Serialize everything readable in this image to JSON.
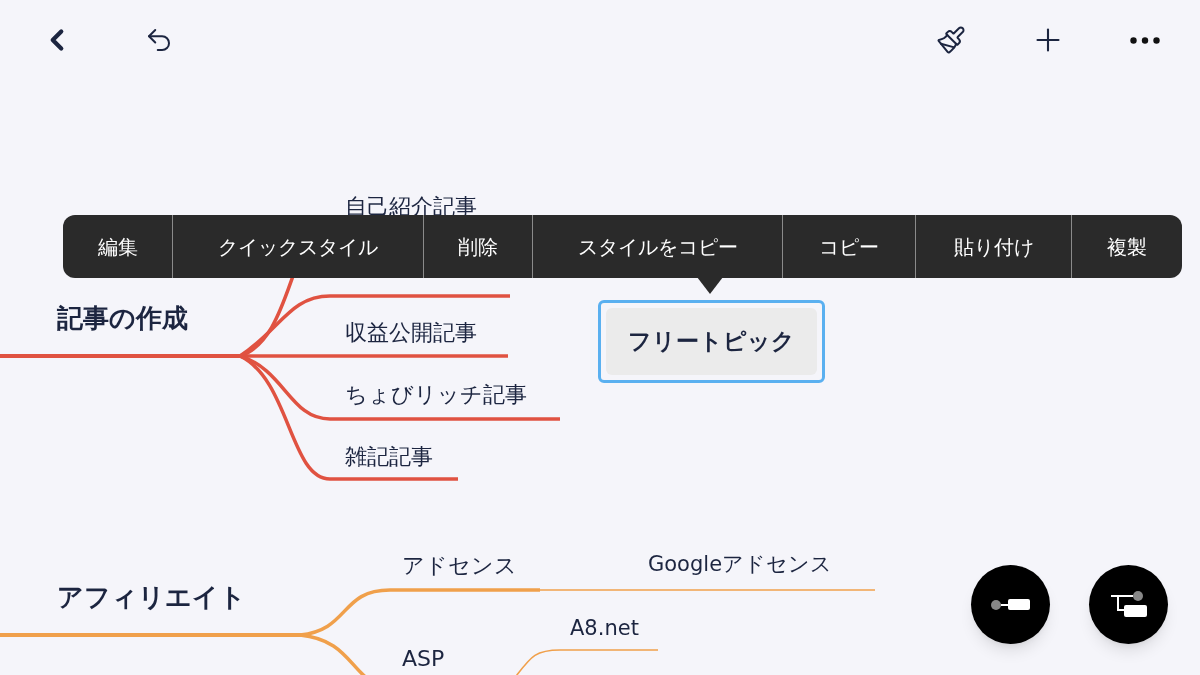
{
  "context_menu": {
    "items": [
      "編集",
      "クイックスタイル",
      "削除",
      "スタイルをコピー",
      "コピー",
      "貼り付け",
      "複製"
    ]
  },
  "topics": [
    {
      "title": "記事の作成",
      "color": "#e05241",
      "children": [
        {
          "label": "自己紹介記事"
        },
        {
          "label": "収益公開記事"
        },
        {
          "label": "ちょびリッチ記事"
        },
        {
          "label": "雑記記事"
        }
      ]
    },
    {
      "title": "アフィリエイト",
      "color": "#f0a04b",
      "children": [
        {
          "label": "アドセンス",
          "children": [
            {
              "label": "Googleアドセンス"
            }
          ]
        },
        {
          "label": "ASP",
          "children": [
            {
              "label": "A8.net"
            }
          ]
        }
      ]
    }
  ],
  "floating_topic": {
    "label": "フリートピック",
    "selected": true
  }
}
